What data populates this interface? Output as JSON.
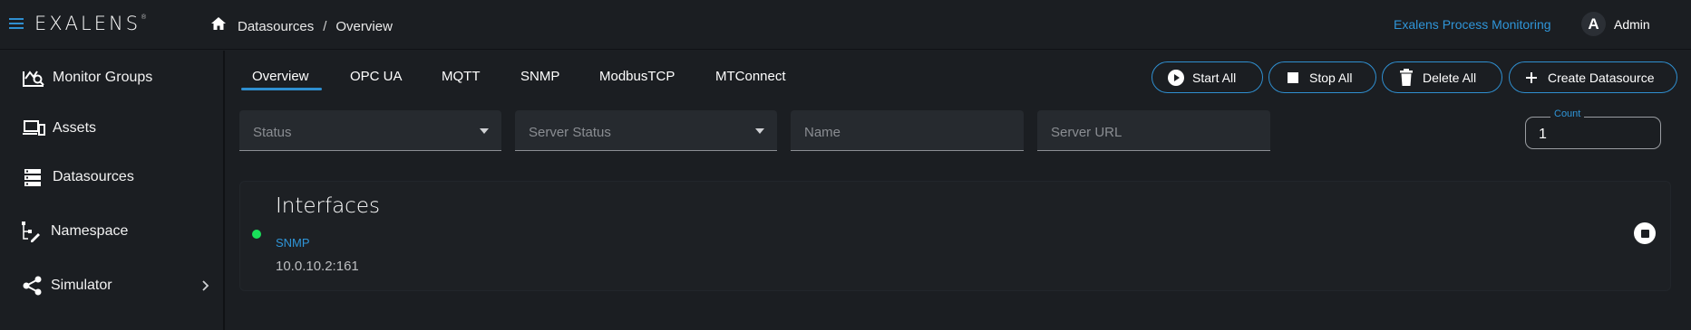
{
  "header": {
    "logo": "EXALENS",
    "logo_mark": "®",
    "breadcrumb": [
      "Datasources",
      "Overview"
    ],
    "breadcrumb_separator": "/",
    "app_name": "Exalens Process Monitoring",
    "user": {
      "initial": "A",
      "name": "Admin"
    }
  },
  "sidebar": {
    "items": [
      {
        "label": "Monitor Groups",
        "icon": "monitor-groups-icon"
      },
      {
        "label": "Assets",
        "icon": "devices-icon"
      },
      {
        "label": "Datasources",
        "icon": "storage-icon"
      },
      {
        "label": "Namespace",
        "icon": "tree-edit-icon"
      },
      {
        "label": "Simulator",
        "icon": "share-icon"
      }
    ]
  },
  "tabs": [
    "Overview",
    "OPC UA",
    "MQTT",
    "SNMP",
    "ModbusTCP",
    "MTConnect"
  ],
  "active_tab": "Overview",
  "actions": {
    "start_all": "Start All",
    "stop_all": "Stop All",
    "delete_all": "Delete All",
    "create": "Create Datasource"
  },
  "filters": {
    "status": "Status",
    "server_status": "Server Status",
    "name": "Name",
    "server_url": "Server URL"
  },
  "count": {
    "label": "Count",
    "value": "1"
  },
  "card": {
    "title": "Interfaces",
    "protocol": "SNMP",
    "url": "10.0.10.2:161",
    "status": "running"
  },
  "colors": {
    "accent": "#2f8fd0",
    "background": "#1b1e22",
    "status_ok": "#19e05a"
  }
}
